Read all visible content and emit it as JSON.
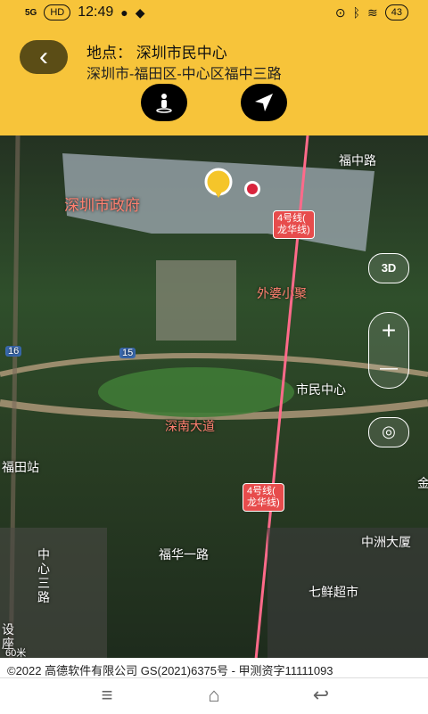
{
  "status": {
    "network": "5G",
    "hd": "HD",
    "time": "12:49",
    "battery": "43"
  },
  "header": {
    "title": "地点： 深圳市民中心",
    "subtitle": "深圳市-福田区-中心区福中三路"
  },
  "map": {
    "labels": {
      "fuzhong_road": "福中路",
      "gov": "深圳市政府",
      "waipo": "外婆小聚",
      "civic_center": "市民中心",
      "shennan": "深南大道",
      "futian_station": "福田站",
      "fuhua_road": "福华一路",
      "zhongzhou": "中洲大厦",
      "qixian": "七鲜超市",
      "zhongxin_san": "中心三路",
      "jin": "金",
      "she": "设",
      "zuo": "座",
      "meters": "60米",
      "sixteen": "16",
      "fifteen": "15"
    },
    "badge1": "4号线(\n龙华线)",
    "badge2": "4号线(\n龙华线)",
    "controls": {
      "three_d": "3D",
      "zoom_in": "+",
      "zoom_out": "—"
    }
  },
  "footer": {
    "copyright": "©2022 高德软件有限公司 GS(2021)6375号 - 甲测资字11111093"
  }
}
